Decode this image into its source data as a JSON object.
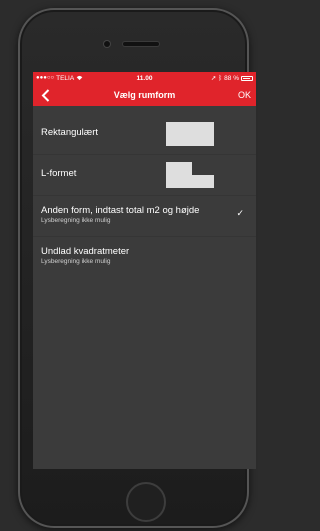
{
  "status_bar": {
    "carrier": "TELIA",
    "time": "11.00",
    "battery": "88 %"
  },
  "nav": {
    "title": "Vælg rumform",
    "ok": "OK"
  },
  "options": [
    {
      "label": "Rektangulært",
      "sublabel": "",
      "selected": false,
      "shape": "rectangle"
    },
    {
      "label": "L-formet",
      "sublabel": "",
      "selected": false,
      "shape": "l-shape"
    },
    {
      "label": "Anden form, indtast total m2 og højde",
      "sublabel": "Lysberegning ikke mulig",
      "selected": true,
      "shape": ""
    },
    {
      "label": "Undlad kvadratmeter",
      "sublabel": "Lysberegning ikke mulig",
      "selected": false,
      "shape": ""
    }
  ],
  "check_mark": "✓",
  "colors": {
    "accent": "#e0242b",
    "screen_bg": "#3b3b3b",
    "shape_fill": "#dedede"
  }
}
